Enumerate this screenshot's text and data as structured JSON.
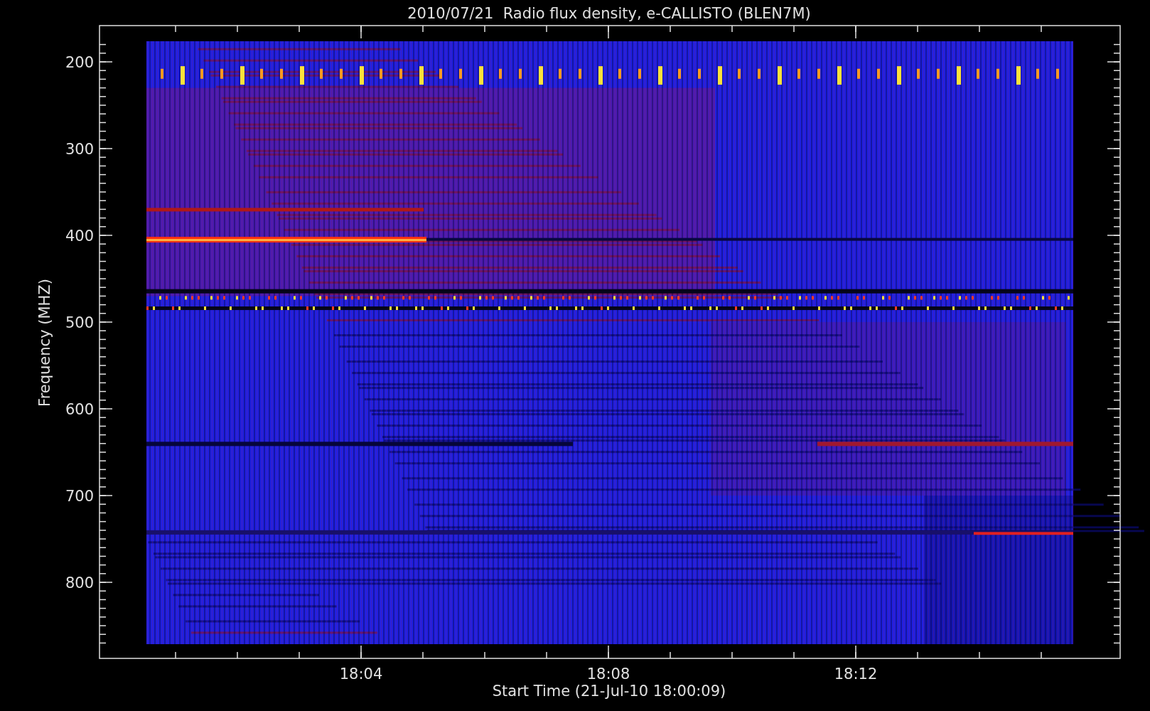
{
  "title": "2010/07/21  Radio flux density, e-CALLISTO (BLEN7M)",
  "y_axis": {
    "label": "Frequency (MHZ)",
    "ticks": [
      "200",
      "300",
      "400",
      "500",
      "600",
      "700",
      "800"
    ]
  },
  "x_axis": {
    "label": "Start Time (21-Jul-10 18:00:09)",
    "ticks": [
      "18:04",
      "18:08",
      "18:12"
    ]
  }
}
